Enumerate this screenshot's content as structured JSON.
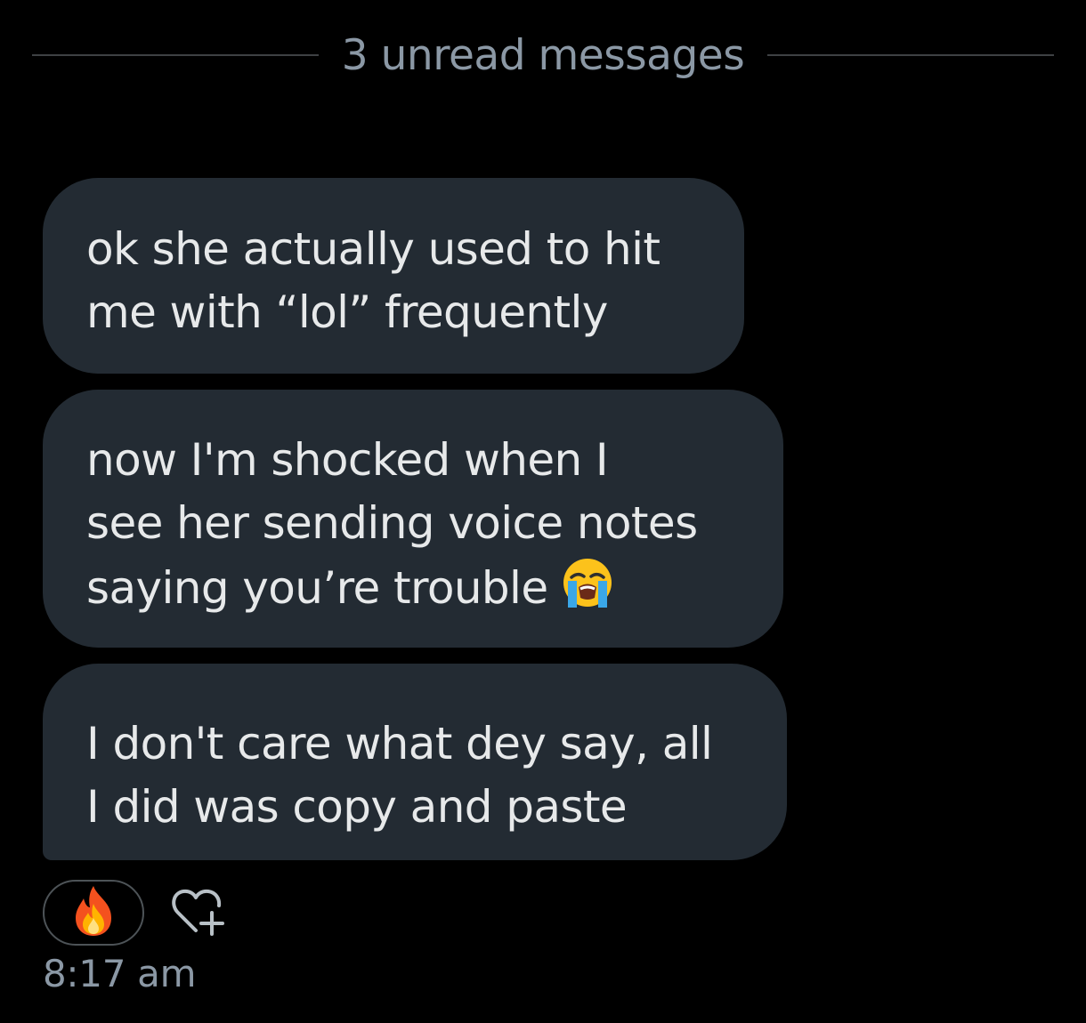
{
  "unread_divider": {
    "label": "3 unread messages"
  },
  "messages": [
    {
      "lines": [
        "ok she actually used to hit",
        "me with “lol” frequently"
      ]
    },
    {
      "lines": [
        "now I'm shocked when I",
        "see her sending voice notes",
        "saying you’re trouble"
      ],
      "emoji": "loudly-crying-face-icon"
    },
    {
      "lines": [
        "I don't care what dey say, all",
        "I did was copy and paste"
      ]
    }
  ],
  "reactions": [
    {
      "emoji": "fire-icon"
    }
  ],
  "add_reaction_icon": "heart-plus-icon",
  "timestamp": "8:17 am",
  "colors": {
    "background": "#000000",
    "bubble": "#232b33",
    "text": "#e7e9ea",
    "muted": "#8b98a5",
    "divider": "#3e4144"
  }
}
